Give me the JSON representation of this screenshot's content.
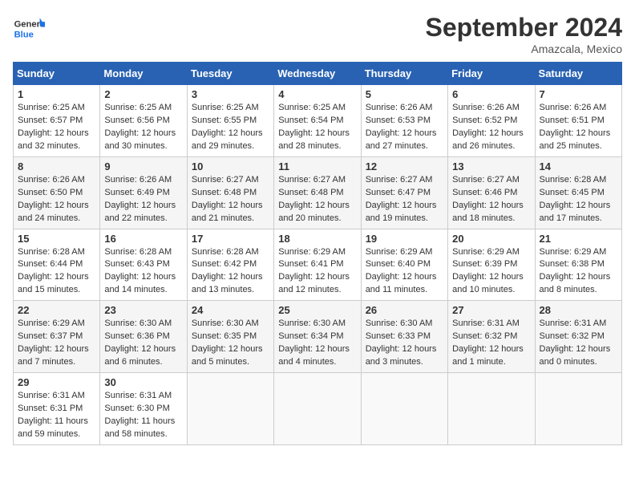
{
  "logo": {
    "line1": "General",
    "line2": "Blue"
  },
  "title": "September 2024",
  "subtitle": "Amazcala, Mexico",
  "headers": [
    "Sunday",
    "Monday",
    "Tuesday",
    "Wednesday",
    "Thursday",
    "Friday",
    "Saturday"
  ],
  "weeks": [
    [
      {
        "day": "1",
        "sunrise": "6:25 AM",
        "sunset": "6:57 PM",
        "daylight": "12 hours and 32 minutes."
      },
      {
        "day": "2",
        "sunrise": "6:25 AM",
        "sunset": "6:56 PM",
        "daylight": "12 hours and 30 minutes."
      },
      {
        "day": "3",
        "sunrise": "6:25 AM",
        "sunset": "6:55 PM",
        "daylight": "12 hours and 29 minutes."
      },
      {
        "day": "4",
        "sunrise": "6:25 AM",
        "sunset": "6:54 PM",
        "daylight": "12 hours and 28 minutes."
      },
      {
        "day": "5",
        "sunrise": "6:26 AM",
        "sunset": "6:53 PM",
        "daylight": "12 hours and 27 minutes."
      },
      {
        "day": "6",
        "sunrise": "6:26 AM",
        "sunset": "6:52 PM",
        "daylight": "12 hours and 26 minutes."
      },
      {
        "day": "7",
        "sunrise": "6:26 AM",
        "sunset": "6:51 PM",
        "daylight": "12 hours and 25 minutes."
      }
    ],
    [
      {
        "day": "8",
        "sunrise": "6:26 AM",
        "sunset": "6:50 PM",
        "daylight": "12 hours and 24 minutes."
      },
      {
        "day": "9",
        "sunrise": "6:26 AM",
        "sunset": "6:49 PM",
        "daylight": "12 hours and 22 minutes."
      },
      {
        "day": "10",
        "sunrise": "6:27 AM",
        "sunset": "6:48 PM",
        "daylight": "12 hours and 21 minutes."
      },
      {
        "day": "11",
        "sunrise": "6:27 AM",
        "sunset": "6:48 PM",
        "daylight": "12 hours and 20 minutes."
      },
      {
        "day": "12",
        "sunrise": "6:27 AM",
        "sunset": "6:47 PM",
        "daylight": "12 hours and 19 minutes."
      },
      {
        "day": "13",
        "sunrise": "6:27 AM",
        "sunset": "6:46 PM",
        "daylight": "12 hours and 18 minutes."
      },
      {
        "day": "14",
        "sunrise": "6:28 AM",
        "sunset": "6:45 PM",
        "daylight": "12 hours and 17 minutes."
      }
    ],
    [
      {
        "day": "15",
        "sunrise": "6:28 AM",
        "sunset": "6:44 PM",
        "daylight": "12 hours and 15 minutes."
      },
      {
        "day": "16",
        "sunrise": "6:28 AM",
        "sunset": "6:43 PM",
        "daylight": "12 hours and 14 minutes."
      },
      {
        "day": "17",
        "sunrise": "6:28 AM",
        "sunset": "6:42 PM",
        "daylight": "12 hours and 13 minutes."
      },
      {
        "day": "18",
        "sunrise": "6:29 AM",
        "sunset": "6:41 PM",
        "daylight": "12 hours and 12 minutes."
      },
      {
        "day": "19",
        "sunrise": "6:29 AM",
        "sunset": "6:40 PM",
        "daylight": "12 hours and 11 minutes."
      },
      {
        "day": "20",
        "sunrise": "6:29 AM",
        "sunset": "6:39 PM",
        "daylight": "12 hours and 10 minutes."
      },
      {
        "day": "21",
        "sunrise": "6:29 AM",
        "sunset": "6:38 PM",
        "daylight": "12 hours and 8 minutes."
      }
    ],
    [
      {
        "day": "22",
        "sunrise": "6:29 AM",
        "sunset": "6:37 PM",
        "daylight": "12 hours and 7 minutes."
      },
      {
        "day": "23",
        "sunrise": "6:30 AM",
        "sunset": "6:36 PM",
        "daylight": "12 hours and 6 minutes."
      },
      {
        "day": "24",
        "sunrise": "6:30 AM",
        "sunset": "6:35 PM",
        "daylight": "12 hours and 5 minutes."
      },
      {
        "day": "25",
        "sunrise": "6:30 AM",
        "sunset": "6:34 PM",
        "daylight": "12 hours and 4 minutes."
      },
      {
        "day": "26",
        "sunrise": "6:30 AM",
        "sunset": "6:33 PM",
        "daylight": "12 hours and 3 minutes."
      },
      {
        "day": "27",
        "sunrise": "6:31 AM",
        "sunset": "6:32 PM",
        "daylight": "12 hours and 1 minute."
      },
      {
        "day": "28",
        "sunrise": "6:31 AM",
        "sunset": "6:32 PM",
        "daylight": "12 hours and 0 minutes."
      }
    ],
    [
      {
        "day": "29",
        "sunrise": "6:31 AM",
        "sunset": "6:31 PM",
        "daylight": "11 hours and 59 minutes."
      },
      {
        "day": "30",
        "sunrise": "6:31 AM",
        "sunset": "6:30 PM",
        "daylight": "11 hours and 58 minutes."
      },
      null,
      null,
      null,
      null,
      null
    ]
  ]
}
